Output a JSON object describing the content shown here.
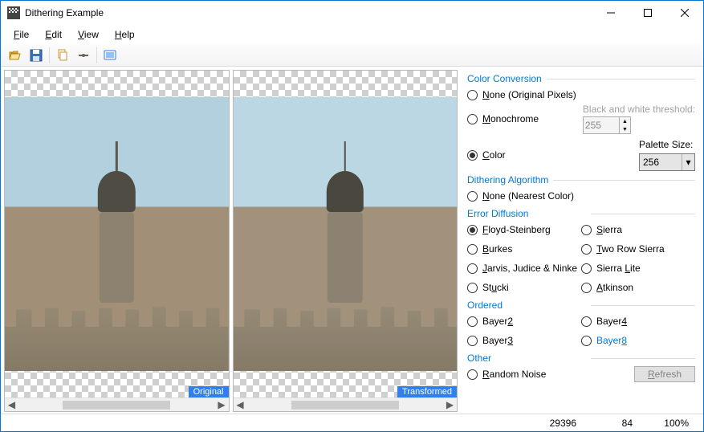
{
  "window": {
    "title": "Dithering Example"
  },
  "menu": {
    "file": "File",
    "edit": "Edit",
    "view": "View",
    "help": "Help"
  },
  "toolbar_icons": [
    "open",
    "save",
    "copy",
    "paste",
    "view-reset"
  ],
  "previews": {
    "original_badge": "Original",
    "transformed_badge": "Transformed"
  },
  "panel": {
    "group_color_conversion": "Color Conversion",
    "cc_none": "None (Original Pixels)",
    "cc_mono": "Monochrome",
    "cc_color": "Color",
    "threshold_label": "Black and white threshold:",
    "threshold_value": "255",
    "palette_label": "Palette Size:",
    "palette_value": "256",
    "group_algorithm": "Dithering Algorithm",
    "alg_none": "None (Nearest Color)",
    "group_errdiff": "Error Diffusion",
    "ed_floyd": "Floyd-Steinberg",
    "ed_sierra": "Sierra",
    "ed_burkes": "Burkes",
    "ed_two_row": "Two Row Sierra",
    "ed_jjn": "Jarvis, Judice & Ninke",
    "ed_sierra_lite": "Sierra Lite",
    "ed_stucki": "Stucki",
    "ed_atkinson": "Atkinson",
    "group_ordered": "Ordered",
    "ord_b2": "Bayer2",
    "ord_b3": "Bayer3",
    "ord_b4": "Bayer4",
    "ord_b8": "Bayer8",
    "group_other": "Other",
    "oth_random": "Random Noise",
    "refresh": "Refresh"
  },
  "status": {
    "a": "29396",
    "b": "84",
    "c": "100%"
  }
}
